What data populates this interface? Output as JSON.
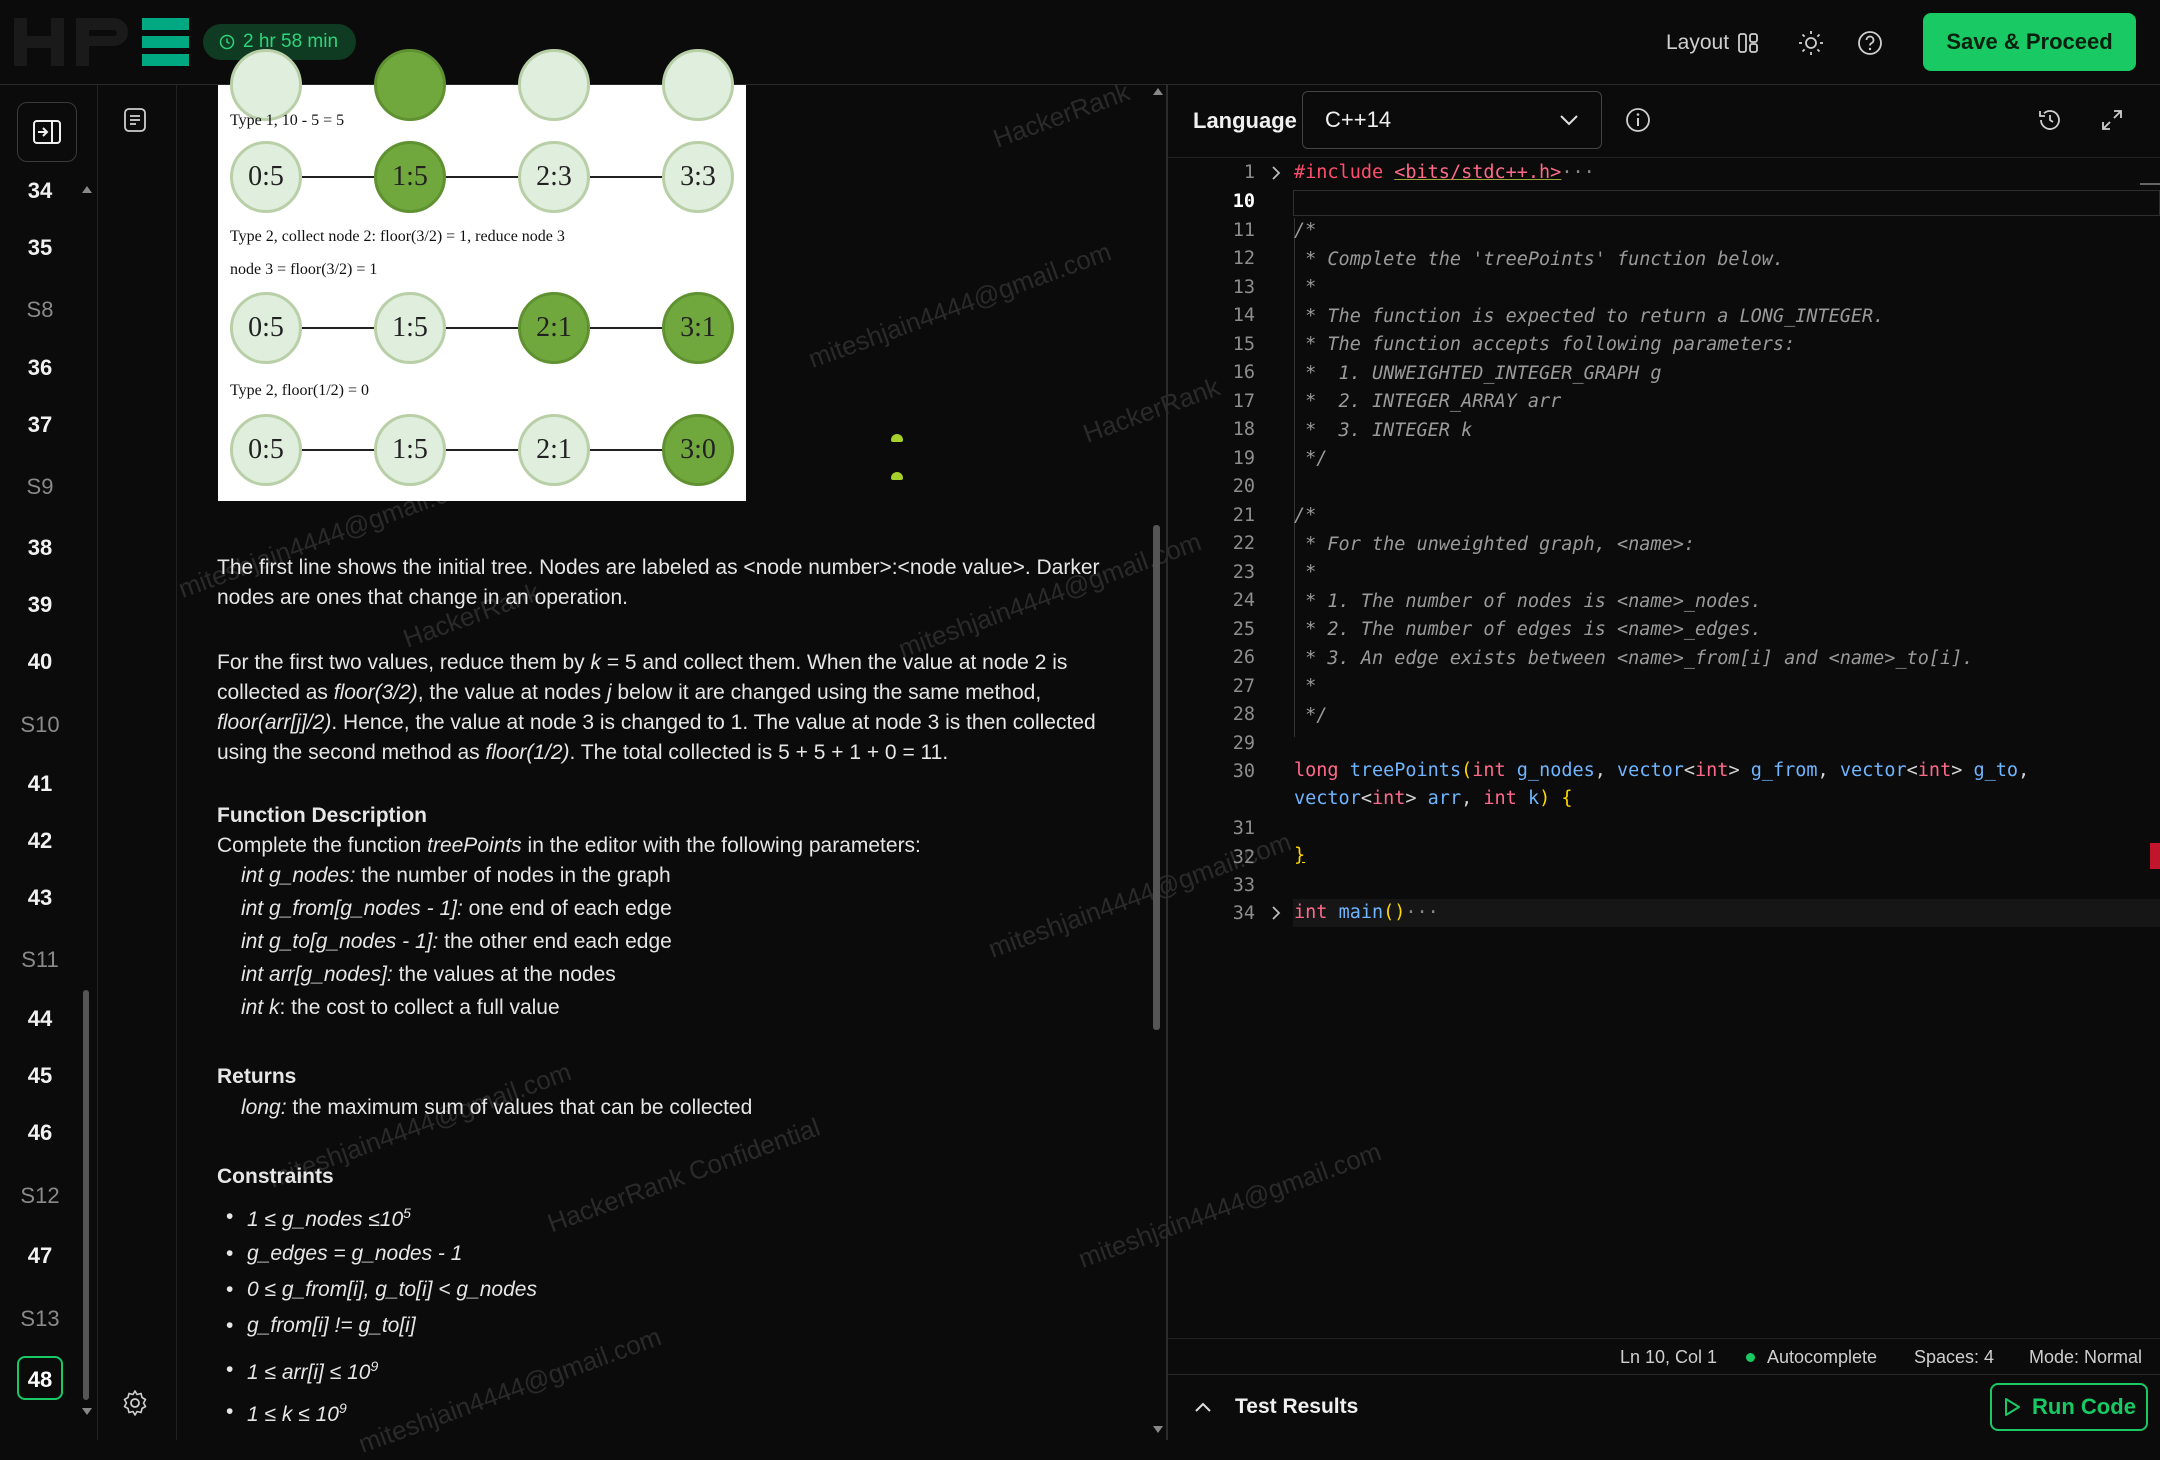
{
  "header": {
    "timer": "2 hr 58 min",
    "layout_label": "Layout",
    "save_label": "Save & Proceed"
  },
  "rail": {
    "items": [
      "34",
      "35",
      "S8",
      "36",
      "37",
      "S9",
      "38",
      "39",
      "40",
      "S10",
      "41",
      "42",
      "43",
      "S11",
      "44",
      "45",
      "46",
      "S12",
      "47",
      "S13",
      "48"
    ],
    "current": "48"
  },
  "diagram": {
    "captions": [
      "Type 1, 10 - 5 = 5",
      "Type 2, collect node 2: floor(3/2) = 1, reduce node 3",
      "node 3 = floor(3/2) = 1",
      "Type 2, floor(1/2) = 0"
    ],
    "rows": [
      [
        "0:5",
        "1:5",
        "2:3",
        "3:3"
      ],
      [
        "0:5",
        "1:5",
        "2:1",
        "3:1"
      ],
      [
        "0:5",
        "1:5",
        "2:1",
        "3:0"
      ]
    ]
  },
  "problem": {
    "p1": "The first line shows the initial tree. Nodes are labeled as <node number>:<node value>. Darker nodes are ones that change in an operation.",
    "p2a": "For the first two values, reduce them by ",
    "p2k": "k",
    "p2b": " = 5 and collect them. When the value at node 2 is collected as ",
    "p2c": "floor(3/2)",
    "p2d": ", the value at nodes ",
    "p2e": "j",
    "p2f": " below it are changed using the same method, ",
    "p2g": "floor(arr[j]/2)",
    "p2h": ". Hence, the value at node 3 is changed to 1. The value at node 3 is then collected using the second method as ",
    "p2i": "floor(1/2)",
    "p2j": ". The total collected is 5 + 5 + 1 + 0 = 11.",
    "fd_title": "Function Description",
    "fd_a": "Complete the function ",
    "fd_fn": "treePoints",
    "fd_b": " in the editor with the following parameters:",
    "params": [
      {
        "name": "int g_nodes:",
        "desc": " the number of nodes in the graph"
      },
      {
        "name": "int g_from[g_nodes - 1]:",
        "desc": " one end of each edge"
      },
      {
        "name": "int g_to[g_nodes - 1]:",
        "desc": " the other end each edge"
      },
      {
        "name": "int arr[g_nodes]:",
        "desc": " the values at the nodes"
      },
      {
        "name": "int k",
        "desc": ": the cost to collect a full value"
      }
    ],
    "returns_title": "Returns",
    "returns_type": "long:",
    "returns_desc": " the maximum sum of values that can be collected",
    "constraints_title": "Constraints",
    "constraints": [
      {
        "text": "1 ≤ g_nodes ≤10",
        "sup": "5"
      },
      {
        "text": "g_edges = g_nodes - 1",
        "sup": ""
      },
      {
        "text": "0 ≤ g_from[i], g_to[i] < g_nodes",
        "sup": ""
      },
      {
        "text": "g_from[i] != g_to[i]",
        "sup": ""
      },
      {
        "text": "1 ≤ arr[i] ≤ 10",
        "sup": "9"
      },
      {
        "text": "1 ≤ k ≤ 10",
        "sup": "9"
      }
    ],
    "watermarks": [
      "HackerRank",
      "miteshjain4444@gmail.com",
      "HackerRank Confidential"
    ]
  },
  "editor": {
    "language_label": "Language",
    "language": "C++14",
    "line_numbers": [
      "1",
      "10",
      "11",
      "12",
      "13",
      "14",
      "15",
      "16",
      "17",
      "18",
      "19",
      "20",
      "21",
      "22",
      "23",
      "24",
      "25",
      "26",
      "27",
      "28",
      "29",
      "30",
      "",
      "31",
      "32",
      "33",
      "34"
    ],
    "current_line": "10",
    "include_kw": "#include",
    "include_hdr": "<bits/stdc++.h>",
    "fold_dots": "···",
    "comment1": [
      "/*",
      " * Complete the 'treePoints' function below.",
      " *",
      " * The function is expected to return a LONG_INTEGER.",
      " * The function accepts following parameters:",
      " *  1. UNWEIGHTED_INTEGER_GRAPH g",
      " *  2. INTEGER_ARRAY arr",
      " *  3. INTEGER k",
      " */"
    ],
    "comment2": [
      "/*",
      " * For the unweighted graph, <name>:",
      " *",
      " * 1. The number of nodes is <name>_nodes.",
      " * 2. The number of edges is <name>_edges.",
      " * 3. An edge exists between <name>_from[i] and <name>_to[i].",
      " *",
      " */"
    ],
    "sig": {
      "ret": "long",
      "fn": "treePoints",
      "t1": "int",
      "p1": "g_nodes",
      "vec": "vector",
      "t2": "int",
      "p2": "g_from",
      "p3": "g_to",
      "p4": "arr",
      "t5": "int",
      "p5": "k"
    },
    "close_brace": "}",
    "main_kw": "int",
    "main_fn": "main",
    "main_parens": "()"
  },
  "status": {
    "position": "Ln 10, Col 1",
    "autocomplete": "Autocomplete",
    "spaces": "Spaces: 4",
    "mode": "Mode: Normal"
  },
  "tests": {
    "title": "Test Results",
    "run_label": "Run Code"
  },
  "colors": {
    "accent": "#18c964",
    "background": "#0b0b0b"
  }
}
